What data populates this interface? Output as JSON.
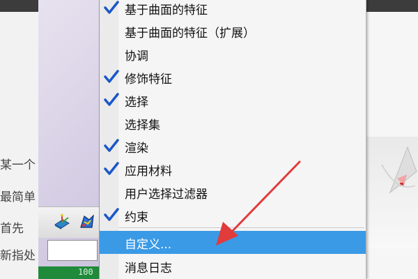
{
  "background": {
    "left_text_lines": [
      "某一个",
      "最简单",
      "首先",
      "新指处"
    ],
    "toolbar_value": "",
    "status_text": "100"
  },
  "menu": {
    "items": [
      {
        "label": "基于曲面的特征",
        "checked": true
      },
      {
        "label": "基于曲面的特征（扩展）",
        "checked": false
      },
      {
        "label": "协调",
        "checked": false
      },
      {
        "label": "修饰特征",
        "checked": true
      },
      {
        "label": "选择",
        "checked": true
      },
      {
        "label": "选择集",
        "checked": false
      },
      {
        "label": "渲染",
        "checked": true
      },
      {
        "label": "应用材料",
        "checked": true
      },
      {
        "label": "用户选择过滤器",
        "checked": false
      },
      {
        "label": "约束",
        "checked": true
      },
      {
        "label": "自定义...",
        "checked": false,
        "highlighted": true
      },
      {
        "label": "消息日志",
        "checked": false
      }
    ]
  },
  "colors": {
    "highlight": "#3a9ae6",
    "check": "#1a56c8",
    "arrow": "#e23b3b"
  },
  "icons": [
    "checkmark-icon",
    "toolbar-axis-icon",
    "toolbar-part-icon"
  ]
}
